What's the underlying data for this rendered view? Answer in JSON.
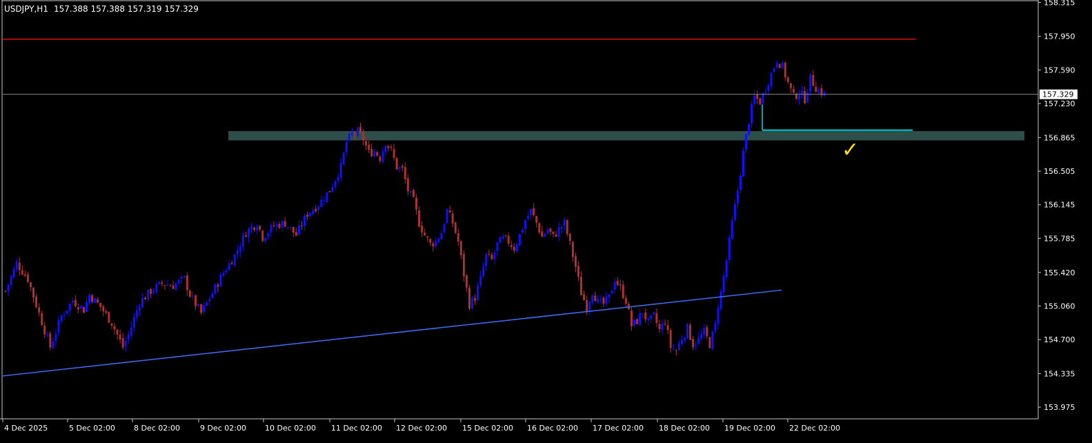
{
  "header": {
    "symbol_tf": "USDJPY,H1",
    "ohlc": "157.388 157.388 157.319 157.329"
  },
  "colors": {
    "background": "#000000",
    "axis": "#c8c8c8",
    "text": "#ffffff",
    "bull": "#1010ff",
    "bear": "#b03030",
    "resistance": "#e01010",
    "price_line": "#8a8a8a",
    "trendline": "#3f6fff",
    "zone": "#2e4e4a",
    "target_line": "#00d8e8",
    "checkmark": "#ffe000",
    "price_tag_bg": "#ffffff",
    "price_tag_text": "#000000"
  },
  "chart_data": {
    "type": "candlestick",
    "symbol": "USDJPY",
    "timeframe": "H1",
    "current_price": 157.329,
    "price_tag": "157.329",
    "ylim": [
      153.85,
      158.34
    ],
    "y_ticks": [
      "158.315",
      "157.950",
      "157.590",
      "157.230",
      "156.865",
      "156.505",
      "156.145",
      "155.785",
      "155.420",
      "155.060",
      "154.700",
      "154.335",
      "153.975"
    ],
    "x_ticks": [
      "4 Dec 2025",
      "5 Dec 02:00",
      "8 Dec 02:00",
      "9 Dec 02:00",
      "10 Dec 02:00",
      "11 Dec 02:00",
      "12 Dec 02:00",
      "15 Dec 02:00",
      "16 Dec 02:00",
      "17 Dec 02:00",
      "18 Dec 02:00",
      "19 Dec 02:00",
      "22 Dec 02:00"
    ],
    "candle_count": 260,
    "close_path": [
      [
        0,
        155.22
      ],
      [
        4,
        155.52
      ],
      [
        8,
        155.35
      ],
      [
        12,
        154.98
      ],
      [
        16,
        154.62
      ],
      [
        20,
        154.95
      ],
      [
        24,
        155.12
      ],
      [
        28,
        155.02
      ],
      [
        30,
        155.18
      ],
      [
        34,
        155.05
      ],
      [
        38,
        154.88
      ],
      [
        42,
        154.62
      ],
      [
        44,
        154.75
      ],
      [
        48,
        155.1
      ],
      [
        52,
        155.22
      ],
      [
        56,
        155.3
      ],
      [
        60,
        155.28
      ],
      [
        64,
        155.35
      ],
      [
        66,
        155.18
      ],
      [
        70,
        154.98
      ],
      [
        74,
        155.2
      ],
      [
        78,
        155.42
      ],
      [
        82,
        155.6
      ],
      [
        86,
        155.85
      ],
      [
        90,
        155.95
      ],
      [
        92,
        155.8
      ],
      [
        96,
        155.92
      ],
      [
        100,
        155.95
      ],
      [
        104,
        155.82
      ],
      [
        108,
        156.05
      ],
      [
        112,
        156.15
      ],
      [
        116,
        156.3
      ],
      [
        120,
        156.55
      ],
      [
        122,
        156.82
      ],
      [
        124,
        156.9
      ],
      [
        126,
        156.92
      ],
      [
        128,
        156.85
      ],
      [
        130,
        156.7
      ],
      [
        132,
        156.72
      ],
      [
        134,
        156.65
      ],
      [
        136,
        156.82
      ],
      [
        138,
        156.72
      ],
      [
        140,
        156.55
      ],
      [
        142,
        156.52
      ],
      [
        144,
        156.3
      ],
      [
        146,
        156.18
      ],
      [
        148,
        155.95
      ],
      [
        150,
        155.82
      ],
      [
        152,
        155.72
      ],
      [
        154,
        155.75
      ],
      [
        156,
        155.85
      ],
      [
        158,
        156.08
      ],
      [
        160,
        155.95
      ],
      [
        162,
        155.75
      ],
      [
        164,
        155.4
      ],
      [
        166,
        155.08
      ],
      [
        168,
        155.15
      ],
      [
        170,
        155.35
      ],
      [
        172,
        155.6
      ],
      [
        174,
        155.55
      ],
      [
        176,
        155.72
      ],
      [
        178,
        155.78
      ],
      [
        180,
        155.75
      ],
      [
        182,
        155.68
      ],
      [
        184,
        155.82
      ],
      [
        186,
        155.98
      ],
      [
        188,
        156.08
      ],
      [
        190,
        155.95
      ],
      [
        192,
        155.8
      ],
      [
        194,
        155.88
      ],
      [
        196,
        155.8
      ],
      [
        198,
        155.88
      ],
      [
        200,
        155.95
      ],
      [
        202,
        155.72
      ],
      [
        204,
        155.48
      ],
      [
        206,
        155.2
      ],
      [
        208,
        155.05
      ],
      [
        210,
        155.22
      ],
      [
        212,
        155.1
      ],
      [
        214,
        155.08
      ],
      [
        216,
        155.15
      ],
      [
        218,
        155.35
      ],
      [
        220,
        155.25
      ],
      [
        222,
        155.12
      ],
      [
        224,
        154.85
      ],
      [
        226,
        154.9
      ],
      [
        228,
        155.0
      ],
      [
        230,
        154.88
      ],
      [
        232,
        154.95
      ],
      [
        234,
        154.8
      ],
      [
        236,
        154.9
      ],
      [
        238,
        154.62
      ],
      [
        240,
        154.58
      ],
      [
        242,
        154.72
      ],
      [
        244,
        154.82
      ],
      [
        246,
        154.65
      ],
      [
        248,
        154.7
      ],
      [
        250,
        154.78
      ],
      [
        252,
        154.65
      ],
      [
        254,
        154.85
      ],
      [
        255,
        155.08
      ]
    ],
    "overlays": [
      {
        "kind": "horizontal_line",
        "name": "resistance-line",
        "price": 157.92
      },
      {
        "kind": "horizontal_line",
        "name": "current-price-line",
        "price": 157.329
      },
      {
        "kind": "zone",
        "name": "support-zone",
        "price_top": 156.935,
        "price_bottom": 156.835
      },
      {
        "kind": "trendline",
        "name": "ascending-trendline",
        "from_price": 154.31,
        "to_price": 155.23
      },
      {
        "kind": "segment",
        "name": "target-segment",
        "price": 156.945
      },
      {
        "kind": "marker",
        "name": "checkmark",
        "glyph": "✓"
      }
    ]
  }
}
